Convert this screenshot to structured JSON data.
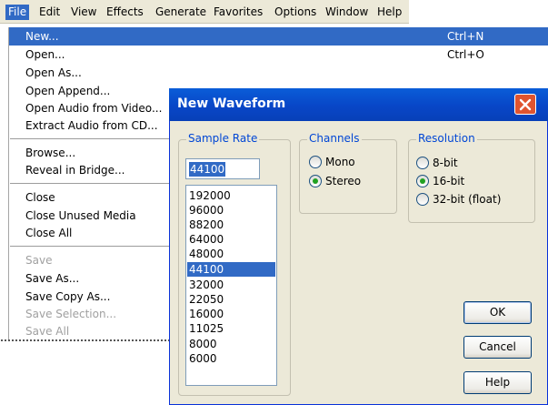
{
  "menubar": {
    "items": [
      "File",
      "Edit",
      "View",
      "Effects",
      "Generate",
      "Favorites",
      "Options",
      "Window",
      "Help"
    ]
  },
  "file_menu": {
    "items": [
      {
        "label": "New...",
        "shortcut": "Ctrl+N",
        "highlighted": true
      },
      {
        "label": "Open...",
        "shortcut": "Ctrl+O"
      },
      {
        "label": "Open As..."
      },
      {
        "label": "Open Append..."
      },
      {
        "label": "Open Audio from Video..."
      },
      {
        "label": "Extract Audio from CD..."
      },
      {
        "label": "Browse..."
      },
      {
        "label": "Reveal in Bridge..."
      },
      {
        "label": "Close"
      },
      {
        "label": "Close Unused Media"
      },
      {
        "label": "Close All"
      },
      {
        "label": "Save",
        "disabled": true
      },
      {
        "label": "Save As..."
      },
      {
        "label": "Save Copy As..."
      },
      {
        "label": "Save Selection...",
        "disabled": true
      },
      {
        "label": "Save All",
        "disabled": true
      }
    ]
  },
  "dialog": {
    "title": "New Waveform",
    "close_icon": "close-icon",
    "sample_rate": {
      "legend": "Sample Rate",
      "value": "44100",
      "options": [
        "192000",
        "96000",
        "88200",
        "64000",
        "48000",
        "44100",
        "32000",
        "22050",
        "16000",
        "11025",
        "8000",
        "6000"
      ],
      "selected": "44100"
    },
    "channels": {
      "legend": "Channels",
      "options": [
        "Mono",
        "Stereo"
      ],
      "selected": "Stereo"
    },
    "resolution": {
      "legend": "Resolution",
      "options": [
        "8-bit",
        "16-bit",
        "32-bit (float)"
      ],
      "selected": "16-bit"
    },
    "buttons": {
      "ok": "OK",
      "cancel": "Cancel",
      "help": "Help"
    }
  },
  "colors": {
    "selection": "#316ac5",
    "title_bar": "#0a5dd8",
    "group_label": "#0046d5",
    "dialog_bg": "#ece9d8",
    "disabled_text": "#a0a0a0",
    "close_button": "#e0542f",
    "radio_dot": "#21a121"
  }
}
